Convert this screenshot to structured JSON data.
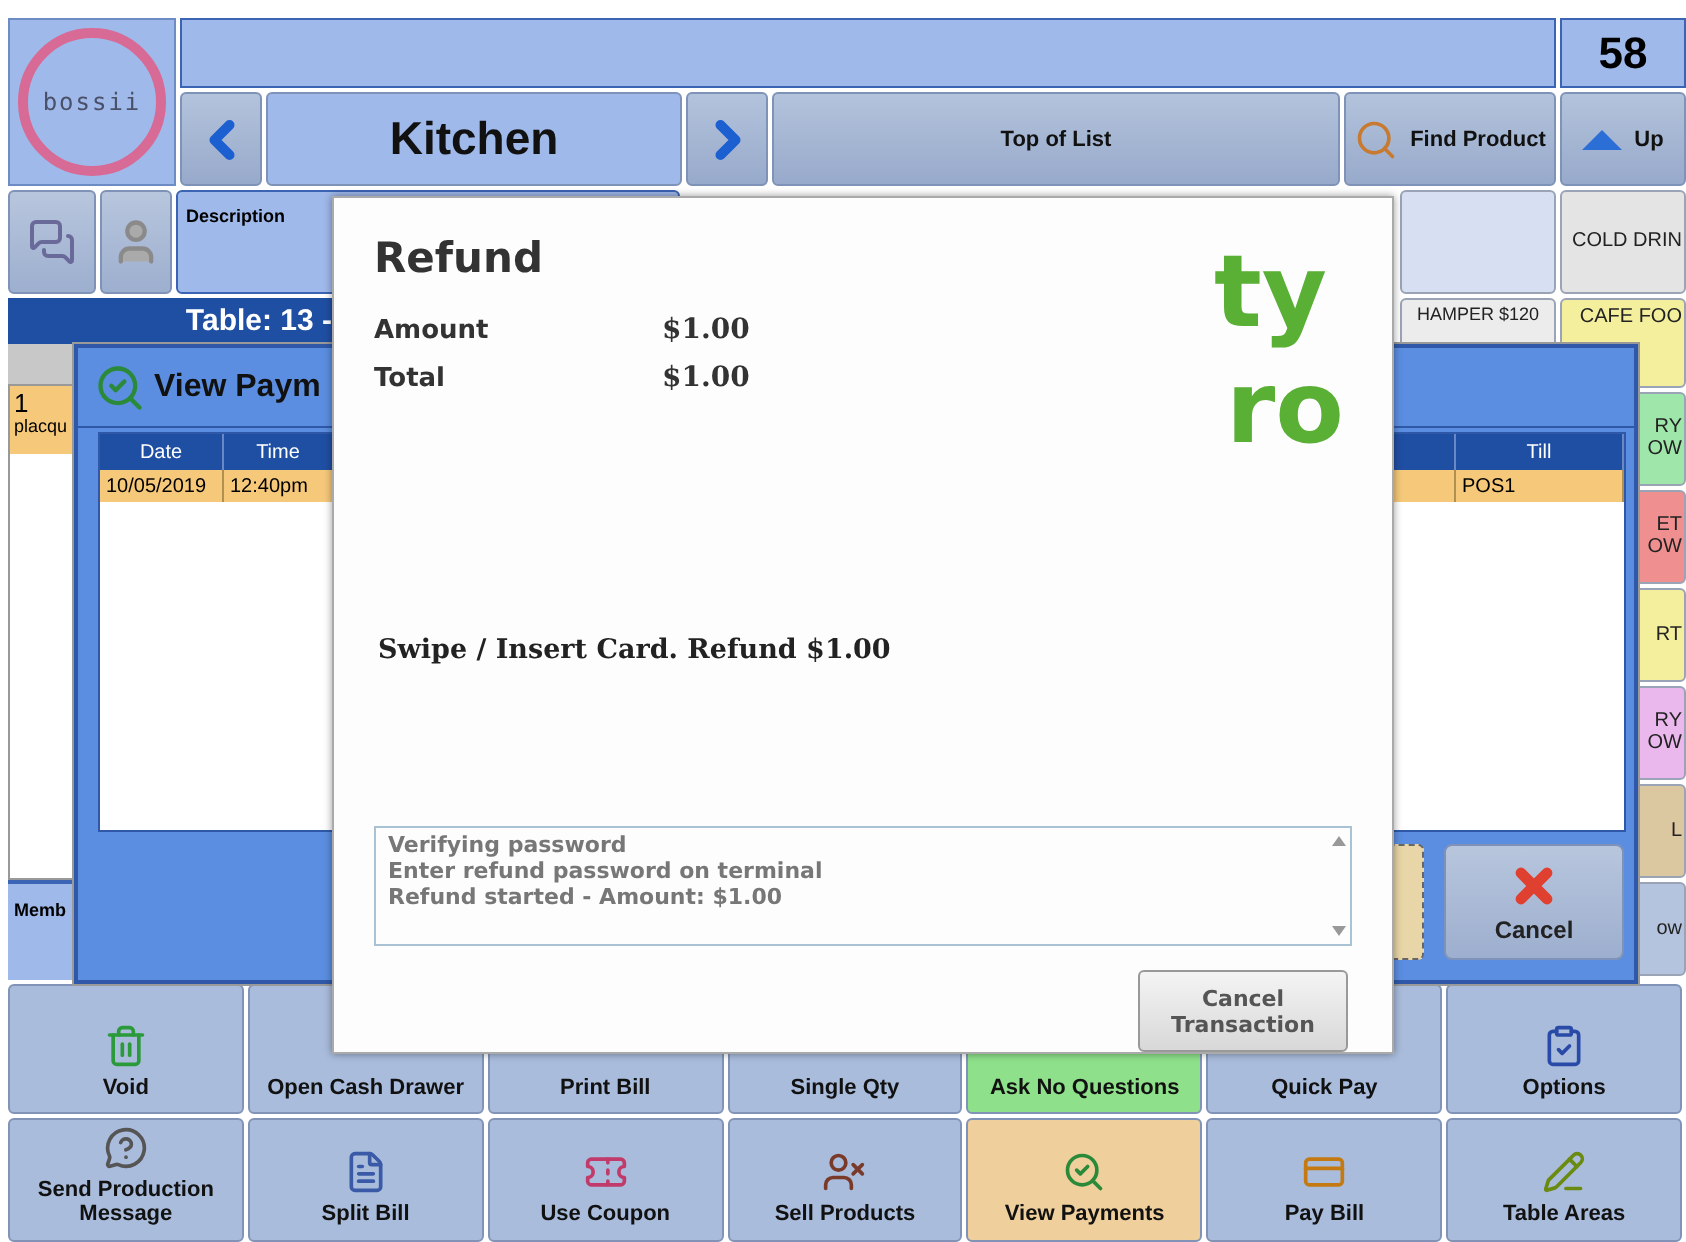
{
  "header": {
    "logo_text": "bossii",
    "counter": "58"
  },
  "nav": {
    "category": "Kitchen",
    "top_of_list": "Top of List",
    "find_product": "Find Product",
    "up": "Up"
  },
  "description": {
    "label": "Description"
  },
  "product_tiles": {
    "top_row": [
      {
        "label": "COLD DRIN",
        "color": "#e4e4e4"
      }
    ],
    "column_1": [
      {
        "label": "HAMPER $120",
        "color": "#ececec"
      }
    ],
    "column_2": [
      {
        "lines": [
          "CAFE FOO"
        ],
        "color": "#f3ef9c"
      },
      {
        "lines": [
          "RY",
          "OW"
        ],
        "color": "#9fe6aa"
      },
      {
        "lines": [
          "ET",
          "OW"
        ],
        "color": "#ef8f8f"
      },
      {
        "lines": [
          "RT"
        ],
        "color": "#f3ef9c"
      },
      {
        "lines": [
          "RY",
          "OW"
        ],
        "color": "#eab8ec"
      },
      {
        "lines": [
          "L"
        ],
        "color": "#dcc8a0"
      },
      {
        "lines": [
          "ow"
        ],
        "color": "#b4c4de"
      }
    ]
  },
  "order": {
    "table_title": "Table: 13 -",
    "items": [
      {
        "qty": "1",
        "name": "placqu",
        "selected": true
      }
    ],
    "member_label": "Memb"
  },
  "view_payments": {
    "title": "View Paym",
    "columns": [
      "Date",
      "Time",
      "Till"
    ],
    "rows": [
      {
        "cells": [
          "10/05/2019",
          "12:40pm",
          "POS1"
        ],
        "selected": true
      }
    ],
    "cancel": "Cancel"
  },
  "refund": {
    "title": "Refund",
    "logo": [
      "ty",
      "ro"
    ],
    "amounts": [
      {
        "label": "Amount",
        "value": "$1.00"
      },
      {
        "label": "Total",
        "value": "$1.00"
      }
    ],
    "prompt": "Swipe / Insert Card. Refund $1.00",
    "log": [
      "Verifying password",
      "Enter refund password on terminal",
      "Refund started - Amount: $1.00"
    ],
    "cancel": "Cancel Transaction"
  },
  "actions": [
    [
      {
        "label": "Void",
        "color": "#a9bcdc"
      },
      {
        "label": "Open Cash Drawer",
        "color": "#a9bcdc"
      },
      {
        "label": "Print Bill",
        "color": "#a9bcdc"
      },
      {
        "label": "Single Qty",
        "color": "#a9bcdc"
      },
      {
        "label": "Ask No Questions",
        "color": "#8ee08a"
      },
      {
        "label": "Quick Pay",
        "color": "#a9bcdc"
      },
      {
        "label": "Options",
        "color": "#a9bcdc"
      }
    ],
    [
      {
        "label": "Send Production Message",
        "color": "#a9bcdc"
      },
      {
        "label": "Split Bill",
        "color": "#a9bcdc"
      },
      {
        "label": "Use Coupon",
        "color": "#a9bcdc"
      },
      {
        "label": "Sell Products",
        "color": "#a9bcdc"
      },
      {
        "label": "View Payments",
        "color": "#efcf9c"
      },
      {
        "label": "Pay Bill",
        "color": "#a9bcdc"
      },
      {
        "label": "Table Areas",
        "color": "#a9bcdc"
      }
    ]
  ]
}
